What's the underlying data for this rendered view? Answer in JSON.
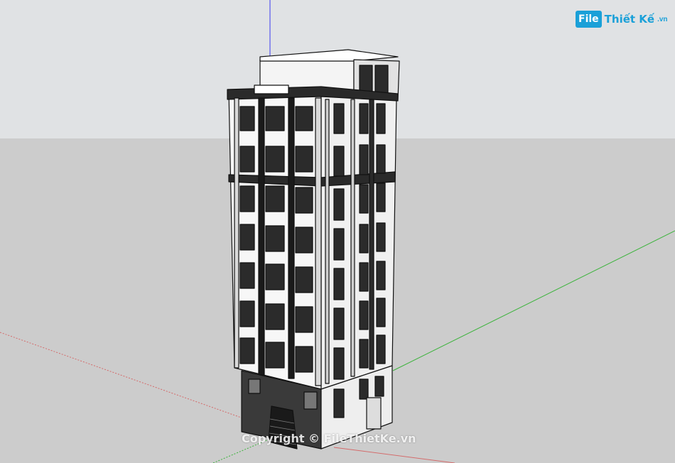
{
  "branding": {
    "logo_file": "File",
    "logo_name": "Thiết Kế",
    "logo_domain": ".vn",
    "watermark": "Copyright © FileThietKe.vn"
  },
  "scene": {
    "sky_color": "#dfe1e3",
    "ground_color": "#cdcdcd",
    "axis_red": "#d46a6a",
    "axis_green": "#3bb33b",
    "axis_blue": "#3a3af0",
    "model": "seven-storey classical townhouse facade, monochrome shaded",
    "icons": [
      "model-building-icon"
    ]
  }
}
